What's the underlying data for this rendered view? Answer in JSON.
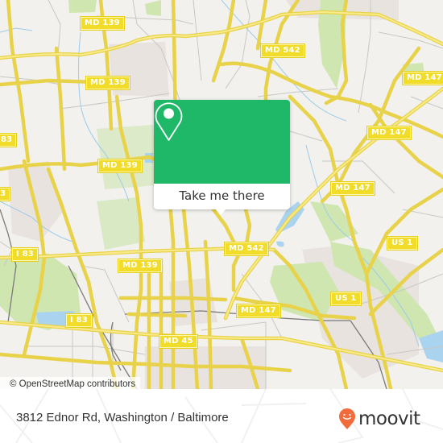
{
  "map": {
    "attribution": "© OpenStreetMap contributors",
    "colors": {
      "background": "#f2f1ee",
      "road_major": "#f5e15a",
      "road_minor": "#c9c7c2",
      "park": "#cfe6b1",
      "water": "#a9d3ee",
      "industrial": "#e9e3e0",
      "shield": "#f2dc2a"
    },
    "shields": [
      {
        "label": "MD 139",
        "id": "md139-a"
      },
      {
        "label": "MD 139",
        "id": "md139-b"
      },
      {
        "label": "MD 542",
        "id": "md542-a"
      },
      {
        "label": "MD 147",
        "id": "md147-a"
      },
      {
        "label": "MD 147",
        "id": "md147-b"
      },
      {
        "label": "MD 147",
        "id": "md147-c"
      },
      {
        "label": "MD 139",
        "id": "md139-c"
      },
      {
        "label": "MD 147",
        "id": "md147-d"
      },
      {
        "label": "83",
        "id": "i83-partial-a"
      },
      {
        "label": "83",
        "id": "i83-partial-b"
      },
      {
        "label": "MD 542",
        "id": "md542-b"
      },
      {
        "label": "US 1",
        "id": "us1-a"
      },
      {
        "label": "MD 139",
        "id": "md139-d"
      },
      {
        "label": "I 83",
        "id": "i83-a"
      },
      {
        "label": "US 1",
        "id": "us1-b"
      },
      {
        "label": "MD 147",
        "id": "md147-e"
      },
      {
        "label": "I 83",
        "id": "i83-b"
      },
      {
        "label": "MD 45",
        "id": "md45"
      }
    ]
  },
  "popup": {
    "icon": "map-pin-icon",
    "button_label": "Take me there",
    "accent": "#1fb868"
  },
  "footer": {
    "address": "3812 Ednor Rd, Washington / Baltimore",
    "brand_name": "moovit",
    "brand_icon": "moovit-smiley-pin-icon",
    "brand_color": "#f26b3a"
  }
}
